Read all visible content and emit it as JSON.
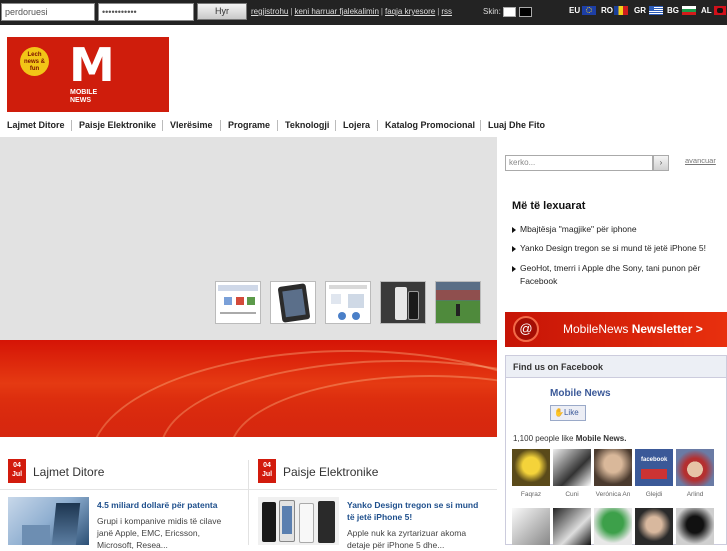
{
  "topbar": {
    "username_value": "perdoruesi",
    "password_value": "•••••••••••",
    "login_label": "Hyr",
    "links": [
      "regjistrohu",
      "keni harruar fjalekalimin",
      "faqja kryesore",
      "rss"
    ],
    "skin_label": "Skin:",
    "languages": [
      "EU",
      "RO",
      "GR",
      "BG",
      "AL"
    ]
  },
  "logo": {
    "badge": "Lech news & fun",
    "mark": "M",
    "word1": "MOBILE",
    "word2": "NEWS"
  },
  "nav": [
    "Lajmet Ditore",
    "Paisje Elektronike",
    "Vlerësime",
    "Programe",
    "Teknologji",
    "Lojera",
    "Katalog Promocional",
    "Luaj Dhe Fito"
  ],
  "search": {
    "placeholder": "kerko...",
    "button": "›",
    "advanced": "avancuar"
  },
  "most_read": {
    "title": "Më të lexuarat",
    "items": [
      "Mbajtësja \"magjike\" për iphone",
      "Yanko Design tregon se si mund të jetë iPhone 5!",
      "GeoHot, tmerri i Apple dhe Sony, tani punon për Facebook"
    ]
  },
  "newsletter": {
    "brand": "MobileNews",
    "label": "Newsletter >"
  },
  "facebook": {
    "header": "Find us on Facebook",
    "page_name": "Mobile News",
    "like": "Like",
    "count_text": "1,100 people like",
    "count_page": "Mobile News.",
    "fans": [
      "Faqraz",
      "Cuni",
      "Verónica An",
      "Glejdi",
      "Arlind"
    ]
  },
  "sections": [
    {
      "day": "04",
      "month": "Jul",
      "title": "Lajmet Ditore",
      "headline": "4.5 miliard dollarë për patenta",
      "text": [
        "Grupi i kompanive midis të cilave",
        "janë Apple, EMC, Ericsson,",
        "Microsoft, Resea..."
      ]
    },
    {
      "day": "04",
      "month": "Jul",
      "title": "Paisje Elektronike",
      "headline": "Yanko Design tregon se si mund",
      "headline2": "të jetë iPhone 5!",
      "text": [
        "Apple nuk ka zyrtarizuar akoma",
        "detaje për iPhone 5 dhe..."
      ]
    }
  ],
  "colors": {
    "brand_red": "#d21b0d",
    "topbar": "#232323",
    "link_blue": "#1e4f8c",
    "facebook_blue": "#3b5998"
  }
}
